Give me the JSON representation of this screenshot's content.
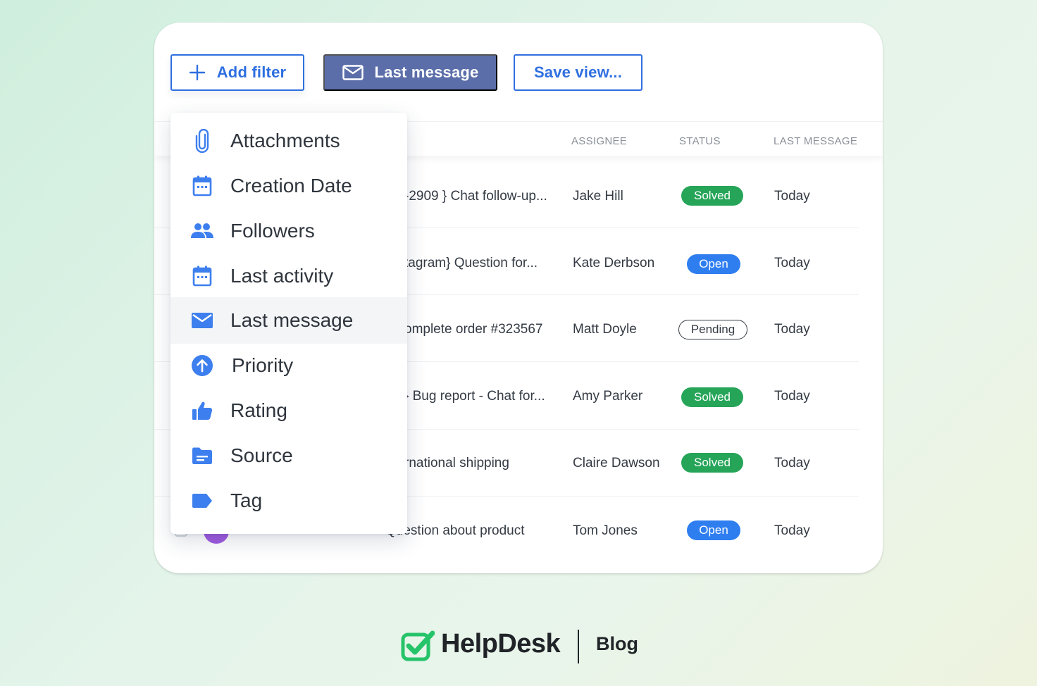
{
  "toolbar": {
    "add_filter_label": "Add filter",
    "last_message_label": "Last message",
    "save_view_label": "Save view..."
  },
  "table": {
    "columns": [
      "ASSIGNEE",
      "STATUS",
      "LAST MESSAGE"
    ],
    "rows": [
      {
        "subject": "-2909 } Chat follow-up...",
        "assignee": "Jake Hill",
        "status": "Solved",
        "last_message": "Today"
      },
      {
        "subject": "tagram} Question for...",
        "assignee": "Kate Derbson",
        "status": "Open",
        "last_message": "Today"
      },
      {
        "subject": "omplete order #323567",
        "assignee": "Matt Doyle",
        "status": "Pending",
        "last_message": "Today"
      },
      {
        "subject": "} Bug report - Chat for...",
        "assignee": "Amy Parker",
        "status": "Solved",
        "last_message": "Today"
      },
      {
        "subject": "rnational shipping",
        "assignee": "Claire Dawson",
        "status": "Solved",
        "last_message": "Today"
      },
      {
        "subject": "Question about product",
        "assignee": "Tom Jones",
        "status": "Open",
        "last_message": "Today"
      }
    ]
  },
  "dropdown": {
    "items": [
      {
        "label": "Attachments",
        "icon": "paperclip-icon"
      },
      {
        "label": "Creation Date",
        "icon": "calendar-icon"
      },
      {
        "label": "Followers",
        "icon": "people-icon"
      },
      {
        "label": "Last activity",
        "icon": "calendar-icon"
      },
      {
        "label": "Last message",
        "icon": "envelope-icon",
        "active": true
      },
      {
        "label": "Priority",
        "icon": "arrow-up-circle-icon"
      },
      {
        "label": "Rating",
        "icon": "thumbs-up-icon"
      },
      {
        "label": "Source",
        "icon": "folder-icon"
      },
      {
        "label": "Tag",
        "icon": "tag-icon"
      }
    ]
  },
  "footer": {
    "brand": "HelpDesk",
    "section": "Blog"
  },
  "colors": {
    "accent_blue": "#2f6fe0",
    "active_button": "#5b6ea9",
    "solved": "#26a559",
    "open": "#2f7ef0",
    "icon_blue": "#3d7fee",
    "brand_green": "#26c46a"
  }
}
